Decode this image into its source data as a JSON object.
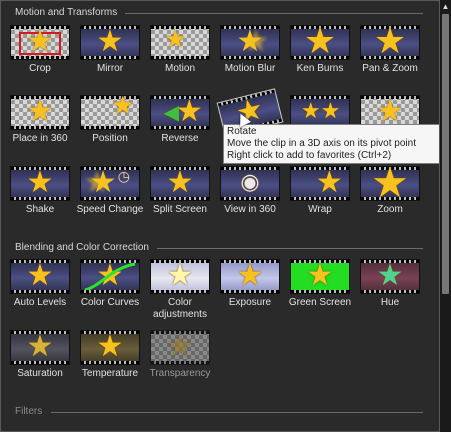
{
  "panel": {
    "sections": [
      {
        "title": "Motion and Transforms",
        "tiles": [
          {
            "label": "Crop",
            "icon": "crop-icon"
          },
          {
            "label": "Mirror",
            "icon": "mirror-icon"
          },
          {
            "label": "Motion",
            "icon": "motion-icon"
          },
          {
            "label": "Motion Blur",
            "icon": "motion-blur-icon"
          },
          {
            "label": "Ken Burns",
            "icon": "ken-burns-icon"
          },
          {
            "label": "Pan & Zoom",
            "icon": "pan-zoom-icon"
          },
          {
            "label": "Place in 360",
            "icon": "place-in-360-icon"
          },
          {
            "label": "Position",
            "icon": "position-icon"
          },
          {
            "label": "Reverse",
            "icon": "reverse-icon"
          },
          {
            "label": "Rotate",
            "icon": "rotate-icon"
          },
          {
            "label": "",
            "icon": "transform-icon"
          },
          {
            "label": "",
            "icon": "transform-icon"
          },
          {
            "label": "Shake",
            "icon": "shake-icon"
          },
          {
            "label": "Speed Change",
            "icon": "speed-change-icon"
          },
          {
            "label": "Split Screen",
            "icon": "split-screen-icon"
          },
          {
            "label": "View in 360",
            "icon": "view-in-360-icon"
          },
          {
            "label": "Wrap",
            "icon": "wrap-icon"
          },
          {
            "label": "Zoom",
            "icon": "zoom-icon"
          }
        ]
      },
      {
        "title": "Blending and Color Correction",
        "tiles": [
          {
            "label": "Auto Levels",
            "icon": "auto-levels-icon"
          },
          {
            "label": "Color Curves",
            "icon": "color-curves-icon"
          },
          {
            "label": "Color adjustments",
            "icon": "color-adjustments-icon"
          },
          {
            "label": "Exposure",
            "icon": "exposure-icon"
          },
          {
            "label": "Green Screen",
            "icon": "green-screen-icon"
          },
          {
            "label": "Hue",
            "icon": "hue-icon"
          },
          {
            "label": "Saturation",
            "icon": "saturation-icon"
          },
          {
            "label": "Temperature",
            "icon": "temperature-icon"
          },
          {
            "label": "Transparency",
            "icon": "transparency-icon"
          }
        ]
      },
      {
        "title": "Filters",
        "tiles": []
      }
    ]
  },
  "tooltip": {
    "line1": "Rotate",
    "line2": "Move the clip in a 3D axis on its pivot point",
    "line3": "Right click to add to favorites (Ctrl+2)"
  },
  "colors": {
    "star": "#f7c21e",
    "panel_bg": "#2a2a2a",
    "crop_frame": "#d41c1c",
    "green_screen": "#22dd22",
    "hue_star": "#4fd38f"
  }
}
